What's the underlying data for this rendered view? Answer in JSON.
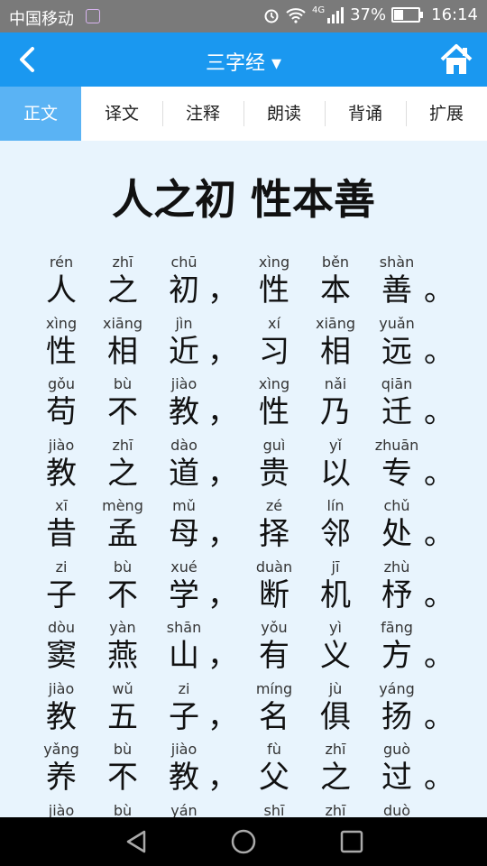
{
  "status": {
    "carrier": "中国移动",
    "network": "4G",
    "battery": "37%",
    "battery_level": 0.37,
    "time": "16:14"
  },
  "header": {
    "title": "三字经 ▾"
  },
  "tabs": [
    "正文",
    "译文",
    "注释",
    "朗读",
    "背诵",
    "扩展"
  ],
  "active_tab": 0,
  "main_title": "人之初 性本善",
  "verses": [
    {
      "p": [
        "rén",
        "zhī",
        "chū",
        "xìng",
        "běn",
        "shàn"
      ],
      "h": [
        "人",
        "之",
        "初",
        "性",
        "本",
        "善"
      ]
    },
    {
      "p": [
        "xìng",
        "xiāng",
        "jìn",
        "xí",
        "xiāng",
        "yuǎn"
      ],
      "h": [
        "性",
        "相",
        "近",
        "习",
        "相",
        "远"
      ]
    },
    {
      "p": [
        "gǒu",
        "bù",
        "jiào",
        "xìng",
        "nǎi",
        "qiān"
      ],
      "h": [
        "苟",
        "不",
        "教",
        "性",
        "乃",
        "迁"
      ]
    },
    {
      "p": [
        "jiào",
        "zhī",
        "dào",
        "guì",
        "yǐ",
        "zhuān"
      ],
      "h": [
        "教",
        "之",
        "道",
        "贵",
        "以",
        "专"
      ]
    },
    {
      "p": [
        "xī",
        "mèng",
        "mǔ",
        "zé",
        "lín",
        "chǔ"
      ],
      "h": [
        "昔",
        "孟",
        "母",
        "择",
        "邻",
        "处"
      ]
    },
    {
      "p": [
        "zi",
        "bù",
        "xué",
        "duàn",
        "jī",
        "zhù"
      ],
      "h": [
        "子",
        "不",
        "学",
        "断",
        "机",
        "杼"
      ]
    },
    {
      "p": [
        "dòu",
        "yàn",
        "shān",
        "yǒu",
        "yì",
        "fāng"
      ],
      "h": [
        "窦",
        "燕",
        "山",
        "有",
        "义",
        "方"
      ]
    },
    {
      "p": [
        "jiào",
        "wǔ",
        "zi",
        "míng",
        "jù",
        "yáng"
      ],
      "h": [
        "教",
        "五",
        "子",
        "名",
        "俱",
        "扬"
      ]
    },
    {
      "p": [
        "yǎng",
        "bù",
        "jiào",
        "fù",
        "zhī",
        "guò"
      ],
      "h": [
        "养",
        "不",
        "教",
        "父",
        "之",
        "过"
      ]
    },
    {
      "p": [
        "jiào",
        "bù",
        "yán",
        "shī",
        "zhī",
        "duò"
      ],
      "h": [
        "",
        "",
        "",
        "",
        "",
        ""
      ]
    }
  ],
  "punct_comma": "，",
  "punct_period": "。"
}
